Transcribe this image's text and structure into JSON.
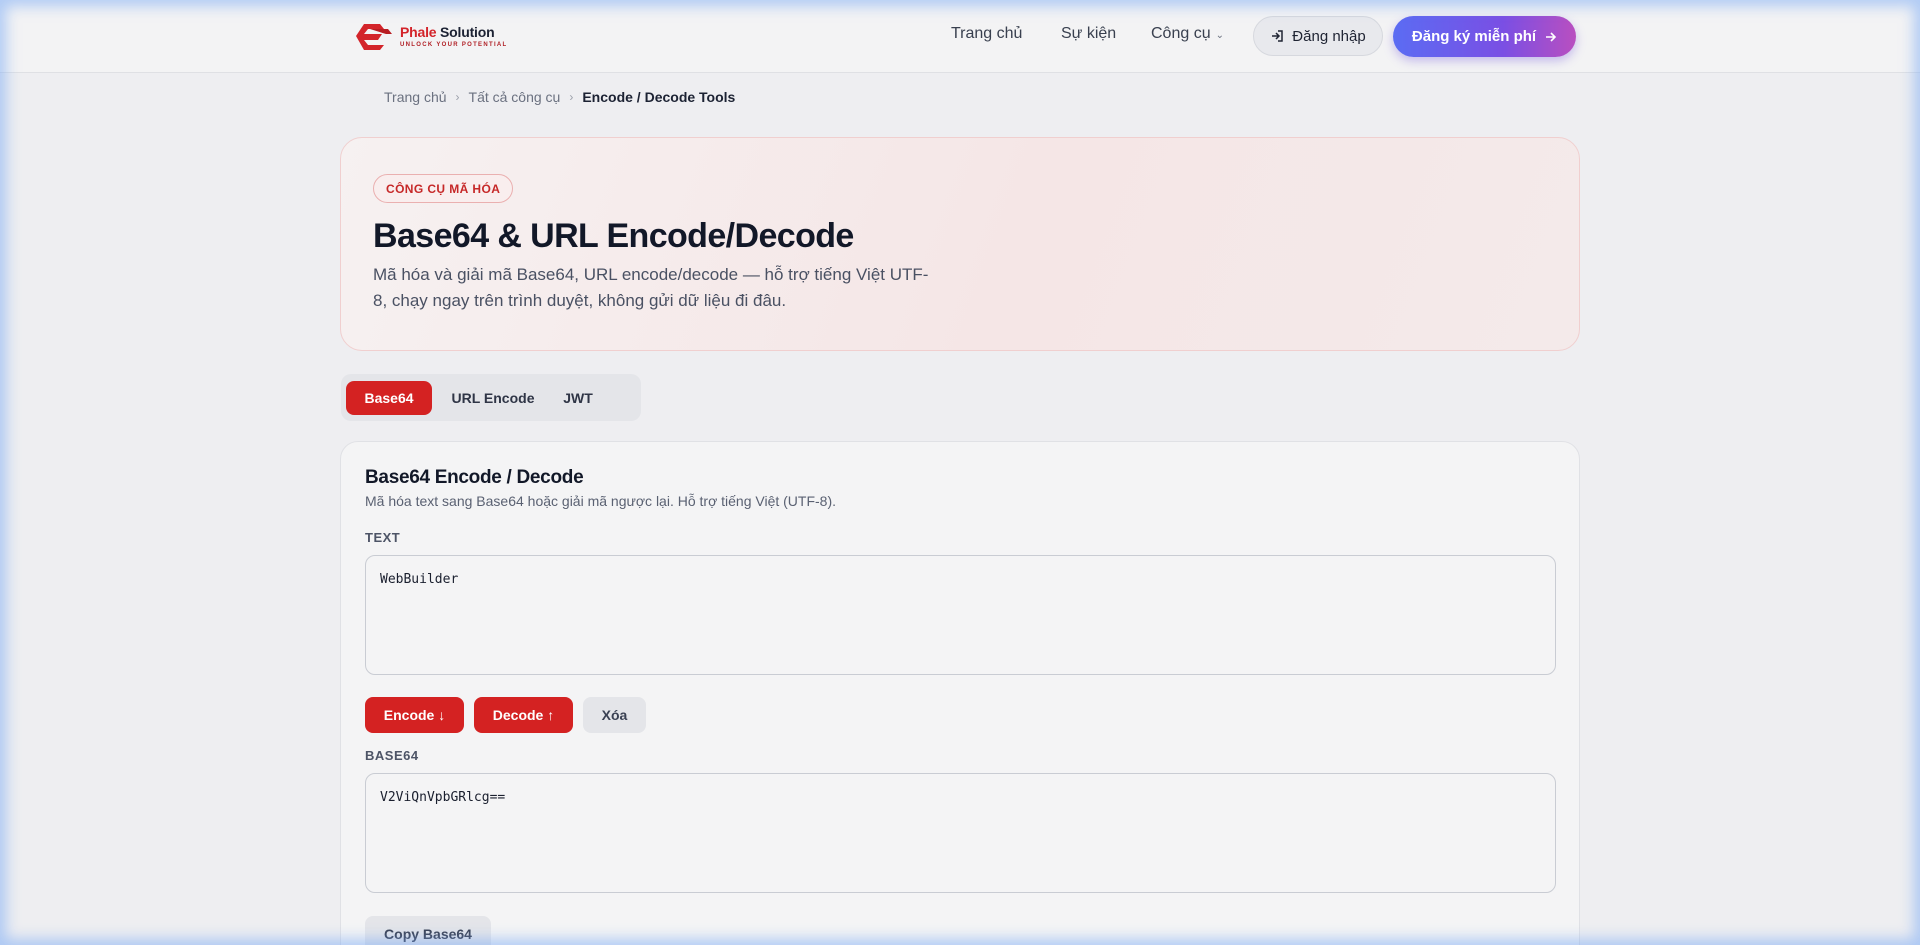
{
  "header": {
    "logo": {
      "name_accent": "Phale",
      "name_rest": " Solution",
      "tagline": "UNLOCK YOUR POTENTIAL"
    },
    "nav": [
      {
        "label": "Trang chủ"
      },
      {
        "label": "Sự kiện"
      },
      {
        "label": "Công cụ"
      }
    ],
    "login_label": "Đăng nhập",
    "signup_label": "Đăng ký miễn phí",
    "colors": {
      "accent": "#d42222",
      "signup_gradient_start": "#5b6cf3",
      "signup_gradient_end": "#b94fc0"
    }
  },
  "breadcrumb": [
    {
      "label": "Trang chủ"
    },
    {
      "label": "Tất cả công cụ"
    },
    {
      "label": "Encode / Decode Tools"
    }
  ],
  "hero": {
    "badge": "CÔNG CỤ MÃ HÓA",
    "title": "Base64 & URL Encode/Decode",
    "description": "Mã hóa và giải mã Base64, URL encode/decode — hỗ trợ tiếng Việt UTF-8, chạy ngay trên trình duyệt, không gửi dữ liệu đi đâu."
  },
  "tabs": [
    {
      "label": "Base64",
      "active": true
    },
    {
      "label": "URL Encode",
      "active": false
    },
    {
      "label": "JWT",
      "active": false
    }
  ],
  "card": {
    "title": "Base64 Encode / Decode",
    "description": "Mã hóa text sang Base64 hoặc giải mã ngược lại. Hỗ trợ tiếng Việt (UTF-8).",
    "text_label": "TEXT",
    "text_value": "WebBuilder",
    "encode_label": "Encode ↓",
    "decode_label": "Decode ↑",
    "clear_label": "Xóa",
    "base64_label": "BASE64",
    "base64_value": "V2ViQnVpbGRlcg==",
    "copy_label": "Copy Base64"
  }
}
